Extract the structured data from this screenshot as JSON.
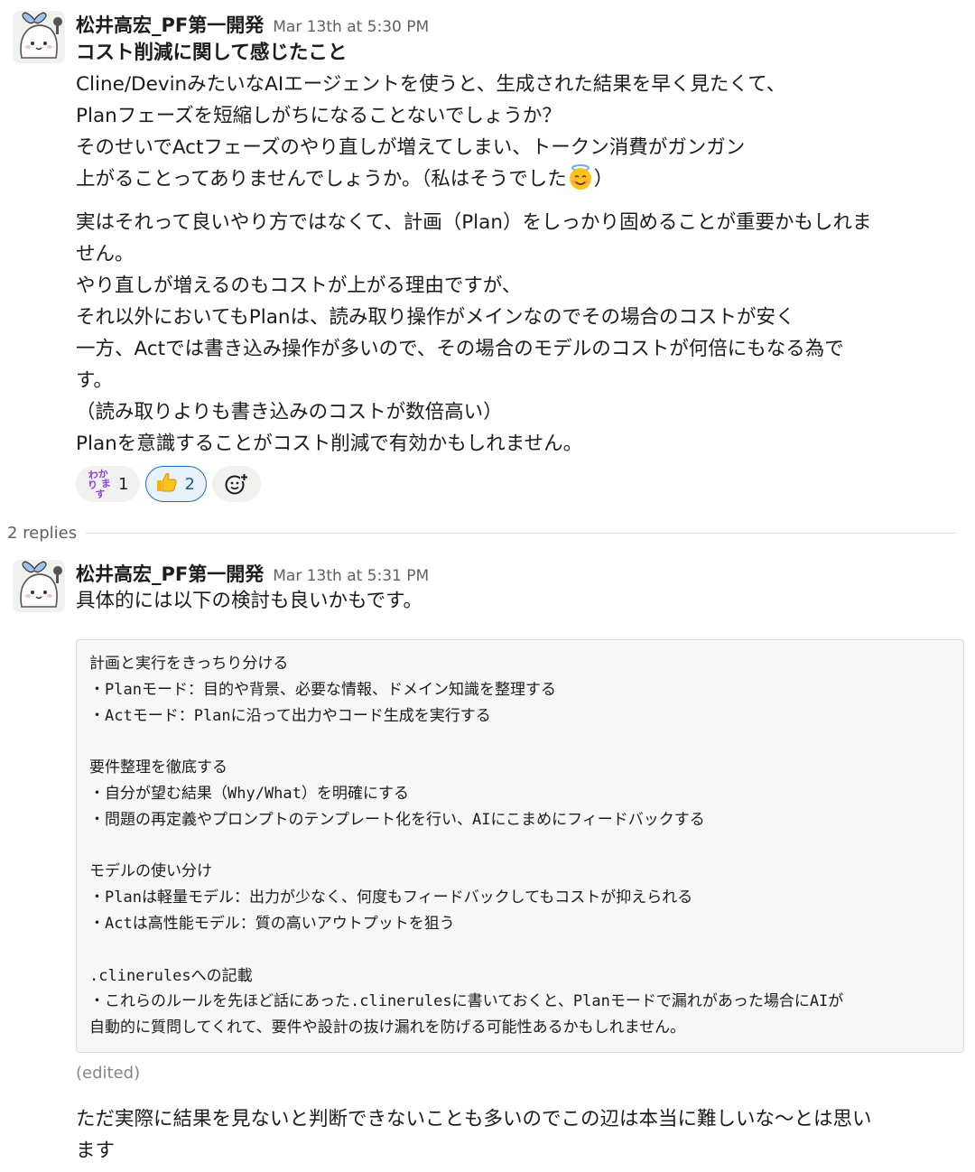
{
  "message1": {
    "author": "松井高宏_PF第一開発",
    "timestamp": "Mar 13th at 5:30 PM",
    "title": "コスト削減に関して感じたこと",
    "lines1": [
      "Cline/DevinみたいなAIエージェントを使うと、生成された結果を早く見たくて、",
      "Planフェーズを短縮しがちになることないでしょうか？",
      "そのせいでActフェーズのやり直しが増えてしまい、トークン消費がガンガン"
    ],
    "line4_before": "上がることってありませんでしょうか。（私はそうでした",
    "line4_emoji": "innocent-emoji",
    "line4_after": "）",
    "lines2": [
      "実はそれって良いやり方ではなくて、計画（Plan）をしっかり固めることが重要かもしれま",
      "せん。",
      "やり直しが増えるのもコストが上がる理由ですが、",
      "それ以外においてもPlanは、読み取り操作がメインなのでその場合のコストが安く",
      "一方、Actでは書き込み操作が多いので、その場合のモデルのコストが何倍にもなる為で",
      "す。",
      "（読み取りよりも書き込みのコストが数倍高い）",
      "Planを意識することがコスト削減で有効かもしれません。"
    ],
    "reactions": [
      {
        "emoji_text": "わかり ます",
        "icon": "wakarimasu-emoji",
        "count": "1"
      },
      {
        "icon": "thumbs-up-emoji",
        "count": "2"
      }
    ],
    "add_reaction_icon": "add-reaction-icon"
  },
  "replies_label": "2 replies",
  "message2": {
    "author": "松井高宏_PF第一開発",
    "timestamp": "Mar 13th at 5:31 PM",
    "text": "具体的には以下の検討も良いかもです。",
    "code_lines": [
      "計画と実行をきっちり分ける",
      "・Planモード：目的や背景、必要な情報、ドメイン知識を整理する",
      "・Actモード：Planに沿って出力やコード生成を実行する",
      "",
      "要件整理を徹底する",
      "・自分が望む結果（Why/What）を明確にする",
      "・問題の再定義やプロンプトのテンプレート化を行い、AIにこまめにフィードバックする",
      "",
      "モデルの使い分け",
      "・Planは軽量モデル：出力が少なく、何度もフィードバックしてもコストが抑えられる",
      "・Actは高性能モデル：質の高いアウトプットを狙う",
      "",
      ".clinerulesへの記載",
      "・これらのルールを先ほど話にあった.clinerulesに書いておくと、Planモードで漏れがあった場合にAIが",
      "自動的に質問してくれて、要件や設計の抜け漏れを防げる可能性あるかもしれません。"
    ],
    "edited": "(edited)",
    "followup_lines": [
      "ただ実際に結果を見ないと判断できないことも多いのでこの辺は本当に難しいな〜とは思い",
      "ます"
    ]
  },
  "colors": {
    "text": "#1d1c1d",
    "muted": "#616061",
    "reaction_active_border": "#1d6fb8",
    "reaction_bg": "#f1f1f0"
  }
}
